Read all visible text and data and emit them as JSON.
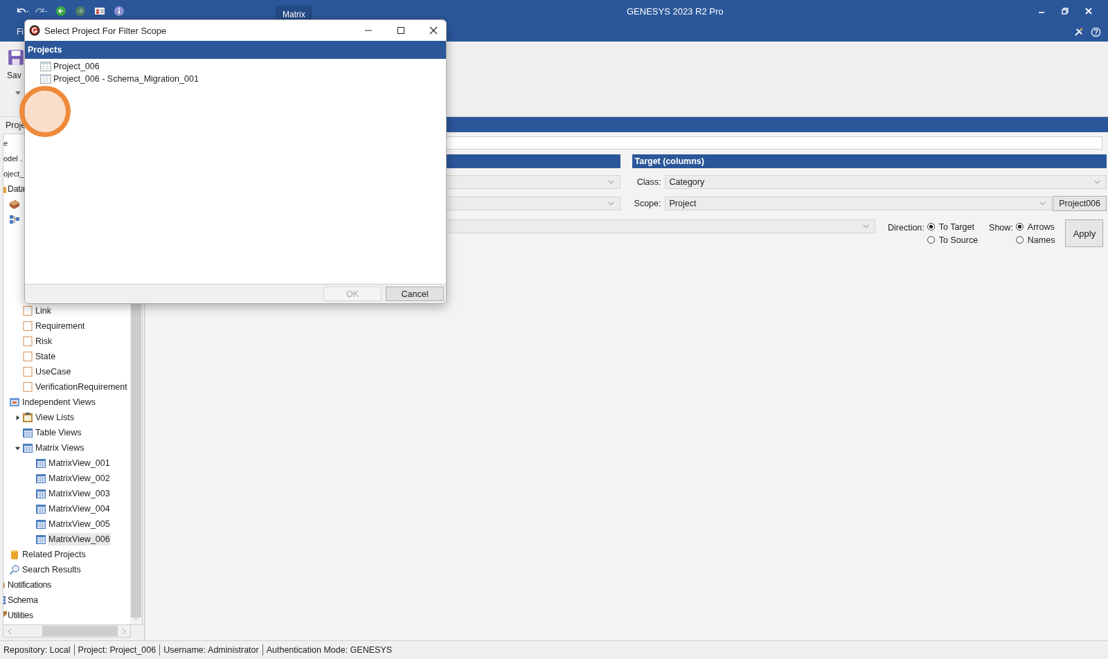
{
  "app": {
    "context_tab": "Matrix",
    "title": "GENESYS 2023 R2 Pro",
    "ribbon_tab": "Fi",
    "save_label": "Sav"
  },
  "sidebar": {
    "tab": "Proje",
    "fragments": [
      "e",
      "odel .",
      "oject_"
    ],
    "tree": [
      {
        "label": "Data",
        "kind": "folder",
        "selected": false,
        "children": [
          {
            "kind": "bricks"
          },
          {
            "kind": "diagram",
            "children": [
              {
                "label": "Link",
                "kind": "class",
                "selected": false
              },
              {
                "label": "Requirement",
                "kind": "class",
                "selected": false
              },
              {
                "label": "Risk",
                "kind": "class",
                "selected": false
              },
              {
                "label": "State",
                "kind": "class",
                "selected": false
              },
              {
                "label": "UseCase",
                "kind": "class",
                "selected": false
              },
              {
                "label": "VerificationRequirement",
                "kind": "class",
                "selected": false
              }
            ]
          },
          {
            "label": "Independent Views",
            "kind": "views",
            "selected": false,
            "children": [
              {
                "label": "View Lists",
                "kind": "list",
                "selected": false,
                "expanded": false
              },
              {
                "label": "Table Views",
                "kind": "table",
                "selected": false
              },
              {
                "label": "Matrix Views",
                "kind": "table",
                "selected": false,
                "expanded": true,
                "children": [
                  {
                    "label": "MatrixView_001",
                    "kind": "matrix",
                    "selected": false
                  },
                  {
                    "label": "MatrixView_002",
                    "kind": "matrix",
                    "selected": false
                  },
                  {
                    "label": "MatrixView_003",
                    "kind": "matrix",
                    "selected": false
                  },
                  {
                    "label": "MatrixView_004",
                    "kind": "matrix",
                    "selected": false
                  },
                  {
                    "label": "MatrixView_005",
                    "kind": "matrix",
                    "selected": false
                  },
                  {
                    "label": "MatrixView_006",
                    "kind": "matrix",
                    "selected": true
                  }
                ]
              }
            ]
          },
          {
            "label": "Related Projects",
            "kind": "cylinder",
            "selected": false
          },
          {
            "label": "Search Results",
            "kind": "search",
            "selected": false
          }
        ]
      },
      {
        "label": "Notifications",
        "kind": "bell",
        "selected": false
      },
      {
        "label": "Schema",
        "kind": "schema",
        "selected": false
      },
      {
        "label": "Utilities",
        "kind": "utilities",
        "selected": false
      }
    ]
  },
  "target": {
    "title": "Target (columns)",
    "class_label": "Class:",
    "class_value": "Category",
    "scope_label": "Scope:",
    "scope_value": "Project",
    "scope_button": "Project006"
  },
  "direction": {
    "label": "Direction:",
    "options": [
      {
        "label": "To Target",
        "selected": true
      },
      {
        "label": "To Source",
        "selected": false
      }
    ]
  },
  "show": {
    "label": "Show:",
    "options": [
      {
        "label": "Arrows",
        "selected": true
      },
      {
        "label": "Names",
        "selected": false
      }
    ]
  },
  "apply_button": "Apply",
  "dialog": {
    "title": "Select Project For Filter Scope",
    "header": "Projects",
    "items": [
      {
        "label": "Project_006",
        "selected": false
      },
      {
        "label": "Project_006 - Schema_Migration_001",
        "selected": false
      }
    ],
    "ok": {
      "label": "OK",
      "disabled": true
    },
    "cancel": {
      "label": "Cancel",
      "disabled": false
    }
  },
  "status_bar": [
    "Repository: Local",
    "Project: Project_006",
    "Username: Administrator",
    "Authentication Mode: GENESYS"
  ]
}
